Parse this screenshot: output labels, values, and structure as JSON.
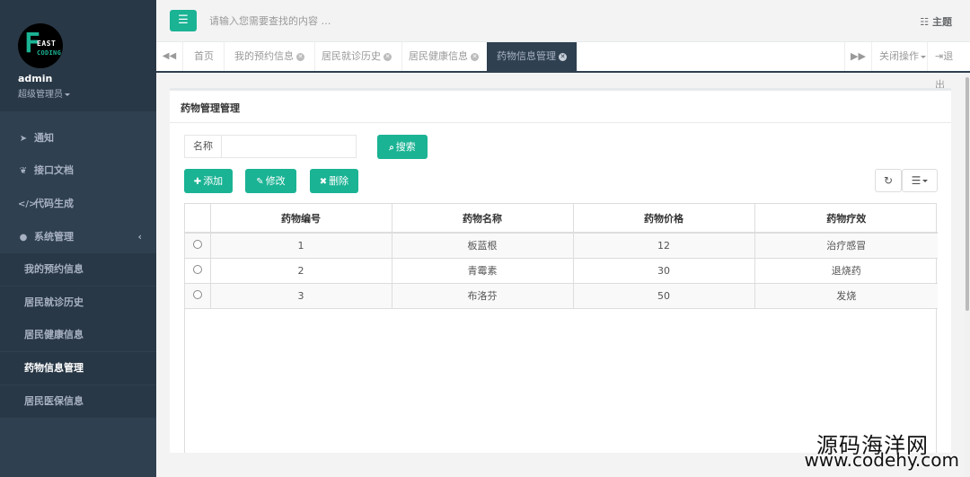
{
  "sidebar": {
    "logo_letter": "F",
    "logo_word1": "EAST",
    "logo_word2": "CODING",
    "user_name": "admin",
    "user_role": "超级管理员",
    "items": [
      {
        "label": "通知",
        "icon": "paper-plane-icon"
      },
      {
        "label": "接口文档",
        "icon": "leaf-icon"
      },
      {
        "label": "代码生成",
        "icon": "code-icon"
      },
      {
        "label": "系统管理",
        "icon": "user-icon"
      }
    ],
    "subitems": [
      {
        "label": "我的预约信息"
      },
      {
        "label": "居民就诊历史"
      },
      {
        "label": "居民健康信息"
      },
      {
        "label": "药物信息管理",
        "active": true
      },
      {
        "label": "居民医保信息"
      }
    ]
  },
  "topbar": {
    "search_placeholder": "请输入您需要查找的内容 …",
    "theme_label": "主题"
  },
  "tabs": [
    {
      "label": "首页"
    },
    {
      "label": "我的预约信息"
    },
    {
      "label": "居民就诊历史"
    },
    {
      "label": "居民健康信息"
    },
    {
      "label": "药物信息管理",
      "active": true
    }
  ],
  "tab_actions": {
    "close_ops": "关闭操作",
    "logout": "退出"
  },
  "panel": {
    "title": "药物管理管理",
    "search_label": "名称",
    "search_value": "",
    "search_button": "搜索",
    "add_button": "添加",
    "edit_button": "修改",
    "delete_button": "删除"
  },
  "table": {
    "columns": [
      "药物编号",
      "药物名称",
      "药物价格",
      "药物疗效"
    ],
    "rows": [
      [
        "1",
        "板蓝根",
        "12",
        "治疗感冒"
      ],
      [
        "2",
        "青霉素",
        "30",
        "退烧药"
      ],
      [
        "3",
        "布洛芬",
        "50",
        "发烧"
      ]
    ]
  },
  "watermark": {
    "line1": "源码海洋网",
    "line2": "www.codehy.com"
  },
  "colors": {
    "accent": "#1ab394",
    "sidebar_bg": "#2f4050",
    "sidebar_dark": "#293846"
  }
}
